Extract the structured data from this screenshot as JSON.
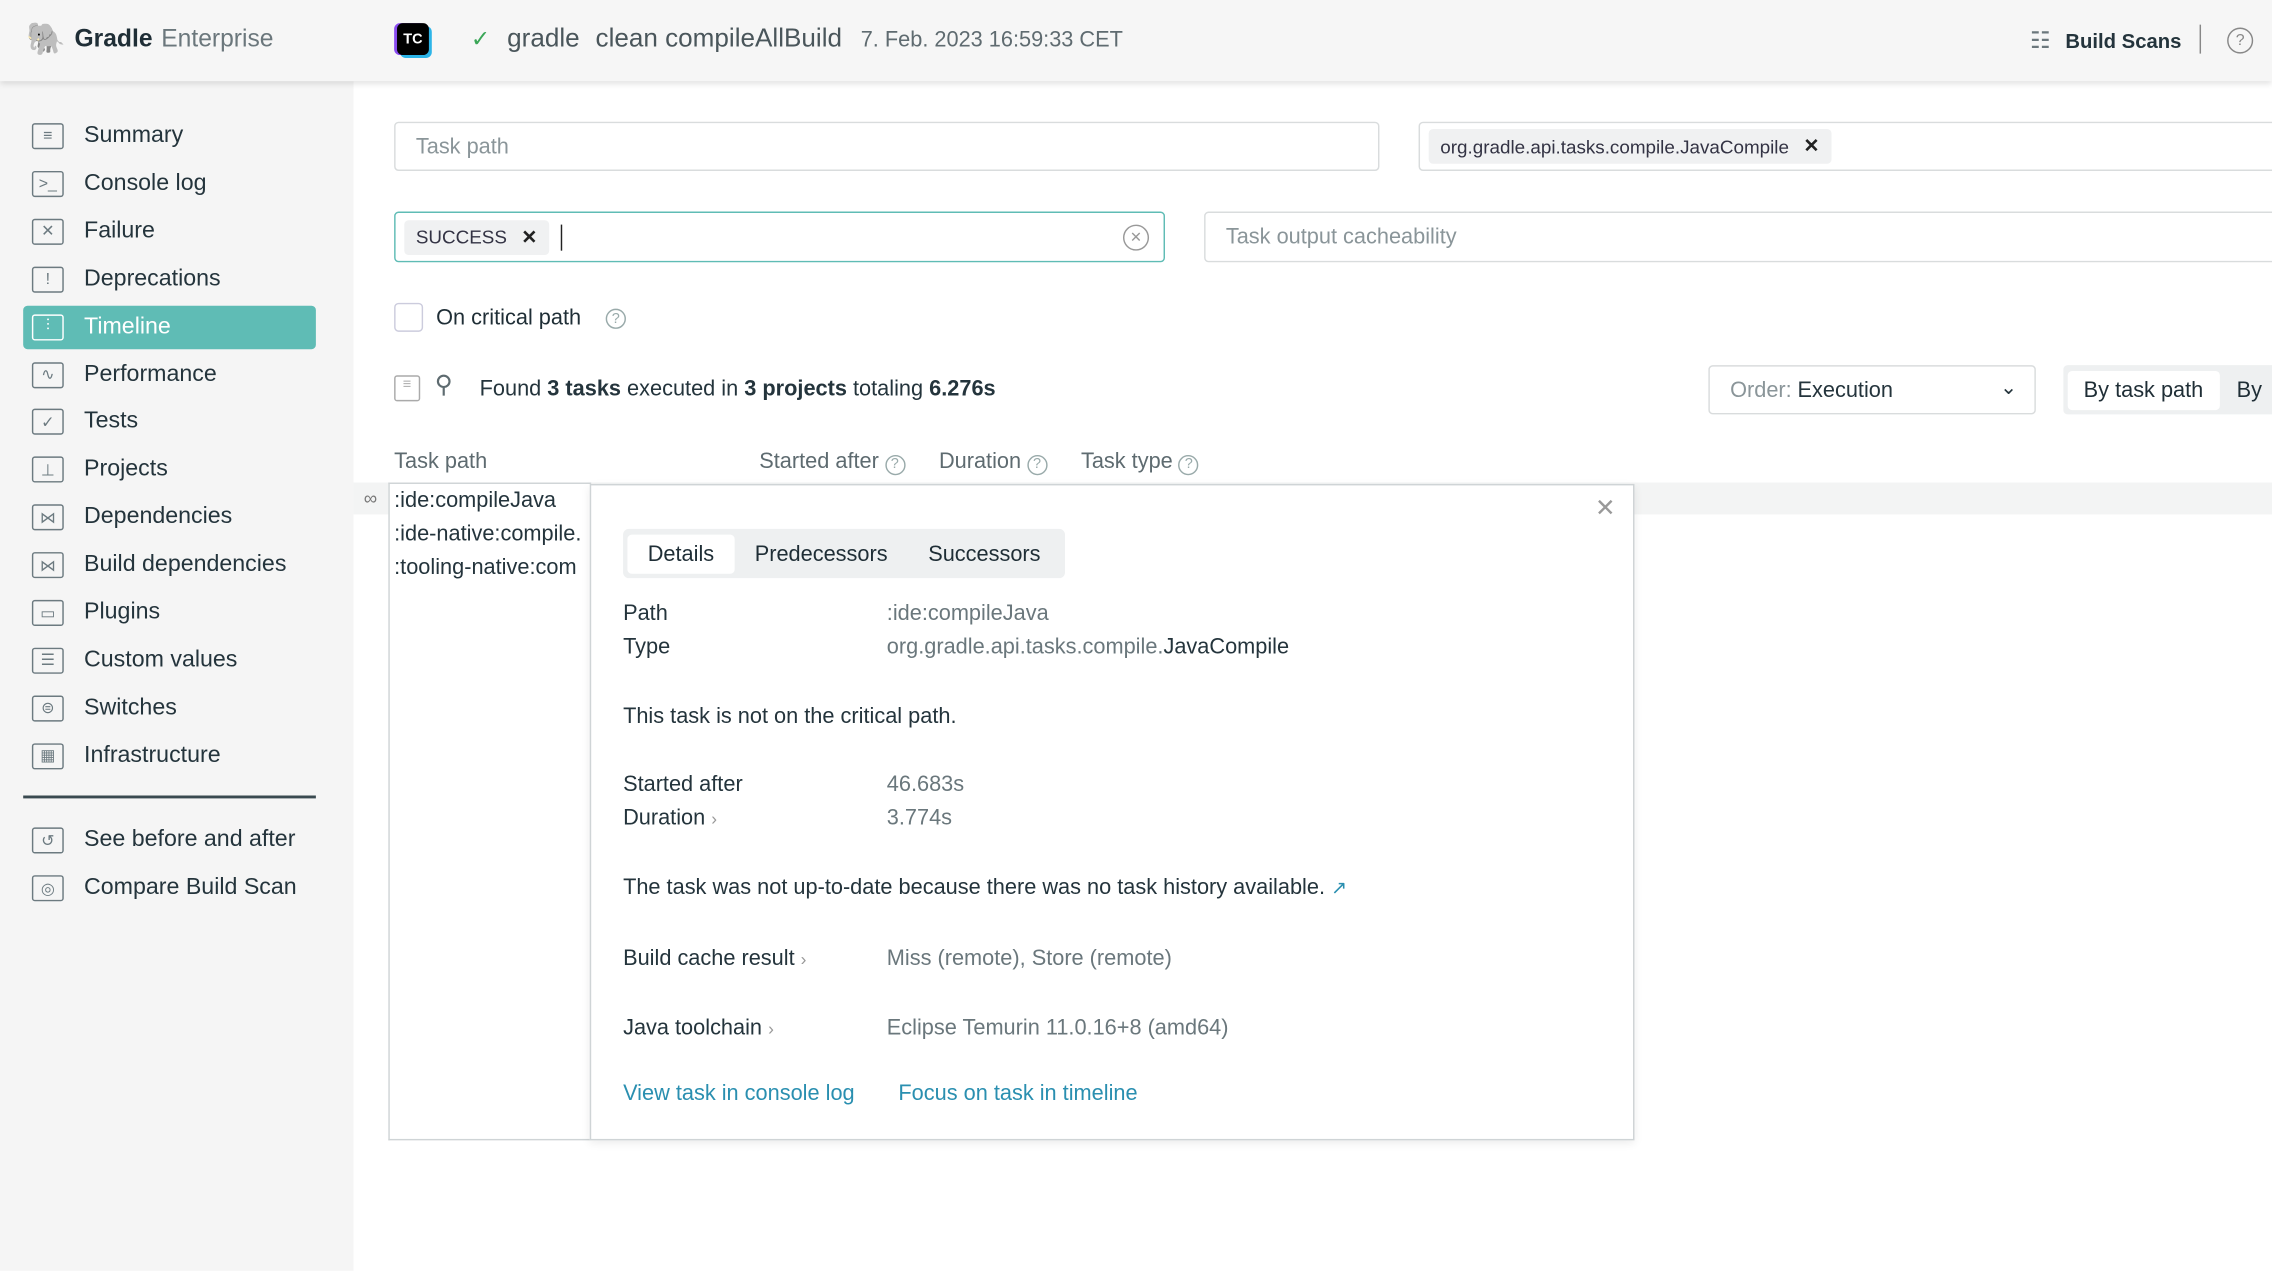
{
  "header": {
    "brand_bold": "Gradle",
    "brand_light": "Enterprise",
    "ci_badge": "TC",
    "project": "gradle",
    "tasks": "clean compileAllBuild",
    "timestamp": "7. Feb. 2023 16:59:33 CET",
    "build_scans": "Build Scans",
    "help": "?"
  },
  "sidebar": {
    "items": [
      {
        "label": "Summary",
        "icon": "≡"
      },
      {
        "label": "Console log",
        "icon": ">_"
      },
      {
        "label": "Failure",
        "icon": "✕"
      },
      {
        "label": "Deprecations",
        "icon": "!"
      },
      {
        "label": "Timeline",
        "icon": "⫶"
      },
      {
        "label": "Performance",
        "icon": "∿"
      },
      {
        "label": "Tests",
        "icon": "✓"
      },
      {
        "label": "Projects",
        "icon": "⊥"
      },
      {
        "label": "Dependencies",
        "icon": "⋈"
      },
      {
        "label": "Build dependencies",
        "icon": "⋈"
      },
      {
        "label": "Plugins",
        "icon": "▭"
      },
      {
        "label": "Custom values",
        "icon": "☰"
      },
      {
        "label": "Switches",
        "icon": "⊜"
      },
      {
        "label": "Infrastructure",
        "icon": "▦"
      }
    ],
    "extra": [
      {
        "label": "See before and after",
        "icon": "↺"
      },
      {
        "label": "Compare Build Scan",
        "icon": "◎"
      }
    ]
  },
  "filters": {
    "task_path_placeholder": "Task path",
    "task_type_chip": "org.gradle.api.tasks.compile.JavaCompile",
    "outcome_chip": "SUCCESS",
    "cacheability_placeholder": "Task output cacheability",
    "critical_path_label": "On critical path"
  },
  "summary": {
    "prefix": "Found ",
    "count": "3 tasks",
    "mid1": " executed in ",
    "projects": "3 projects",
    "mid2": " totaling ",
    "total": "6.276s"
  },
  "order": {
    "label": "Order:",
    "value": "Execution"
  },
  "group_buttons": [
    "By task path",
    "By"
  ],
  "table": {
    "headers": [
      "Task path",
      "Started after",
      "Duration",
      "Task type"
    ],
    "rows": [
      ":ide:compileJava",
      ":ide-native:compile.",
      ":tooling-native:com"
    ]
  },
  "popup": {
    "tabs": [
      "Details",
      "Predecessors",
      "Successors"
    ],
    "path_label": "Path",
    "path_value": ":ide:compileJava",
    "type_label": "Type",
    "type_prefix": "org.gradle.api.tasks.compile.",
    "type_class": "JavaCompile",
    "critical": "This task is not on the critical path.",
    "started_label": "Started after",
    "started_value": "46.683s",
    "duration_label": "Duration",
    "duration_value": "3.774s",
    "uptodate": "The task was not up-to-date because there was no task history available.",
    "cache_label": "Build cache result",
    "cache_value": "Miss (remote), Store (remote)",
    "toolchain_label": "Java toolchain",
    "toolchain_value": "Eclipse Temurin 11.0.16+8 (amd64)",
    "link_console": "View task in console log",
    "link_timeline": "Focus on task in timeline"
  },
  "colors": {
    "accent": "#5fbcb5",
    "link": "#2a8fb0",
    "success": "#3aa657"
  }
}
